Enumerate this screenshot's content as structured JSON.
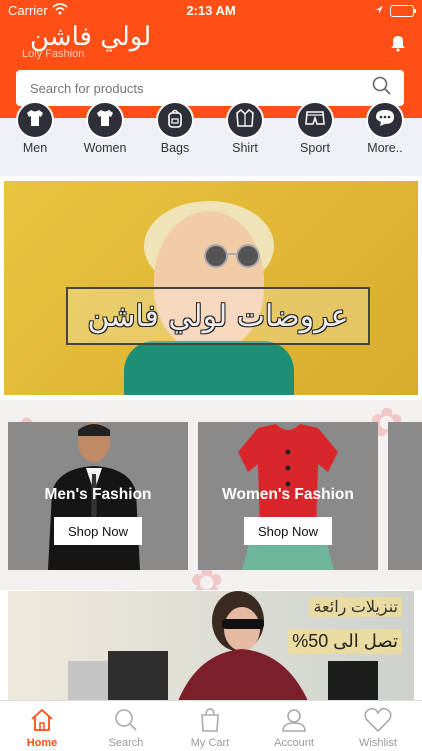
{
  "status_bar": {
    "carrier": "Carrier",
    "time": "2:13 AM"
  },
  "header": {
    "logo_arabic": "لولي فاشن",
    "logo_english": "Loly Fashion",
    "search_placeholder": "Search for products"
  },
  "categories": [
    {
      "label": "Men",
      "icon": "tshirt-icon"
    },
    {
      "label": "Women",
      "icon": "tshirt-icon"
    },
    {
      "label": "Bags",
      "icon": "backpack-icon"
    },
    {
      "label": "Shirt",
      "icon": "shirt-icon"
    },
    {
      "label": "Sport",
      "icon": "shorts-icon"
    },
    {
      "label": "More..",
      "icon": "more-icon"
    }
  ],
  "banner": {
    "text": "عروضات لولي فاشن"
  },
  "promo_cards": [
    {
      "title": "Men's Fashion",
      "button": "Shop Now"
    },
    {
      "title": "Women's Fashion",
      "button": "Shop Now"
    }
  ],
  "sale_banner": {
    "line1": "تنزيلات رائعة",
    "line2": "تصل الى 50%"
  },
  "tab_bar": [
    {
      "label": "Home",
      "icon": "home-icon",
      "active": true
    },
    {
      "label": "Search",
      "icon": "search-icon"
    },
    {
      "label": "My Cart",
      "icon": "cart-icon"
    },
    {
      "label": "Account",
      "icon": "account-icon"
    },
    {
      "label": "Wishlist",
      "icon": "heart-icon"
    }
  ],
  "colors": {
    "brand": "#ff4f17",
    "dark": "#2e2f38"
  }
}
